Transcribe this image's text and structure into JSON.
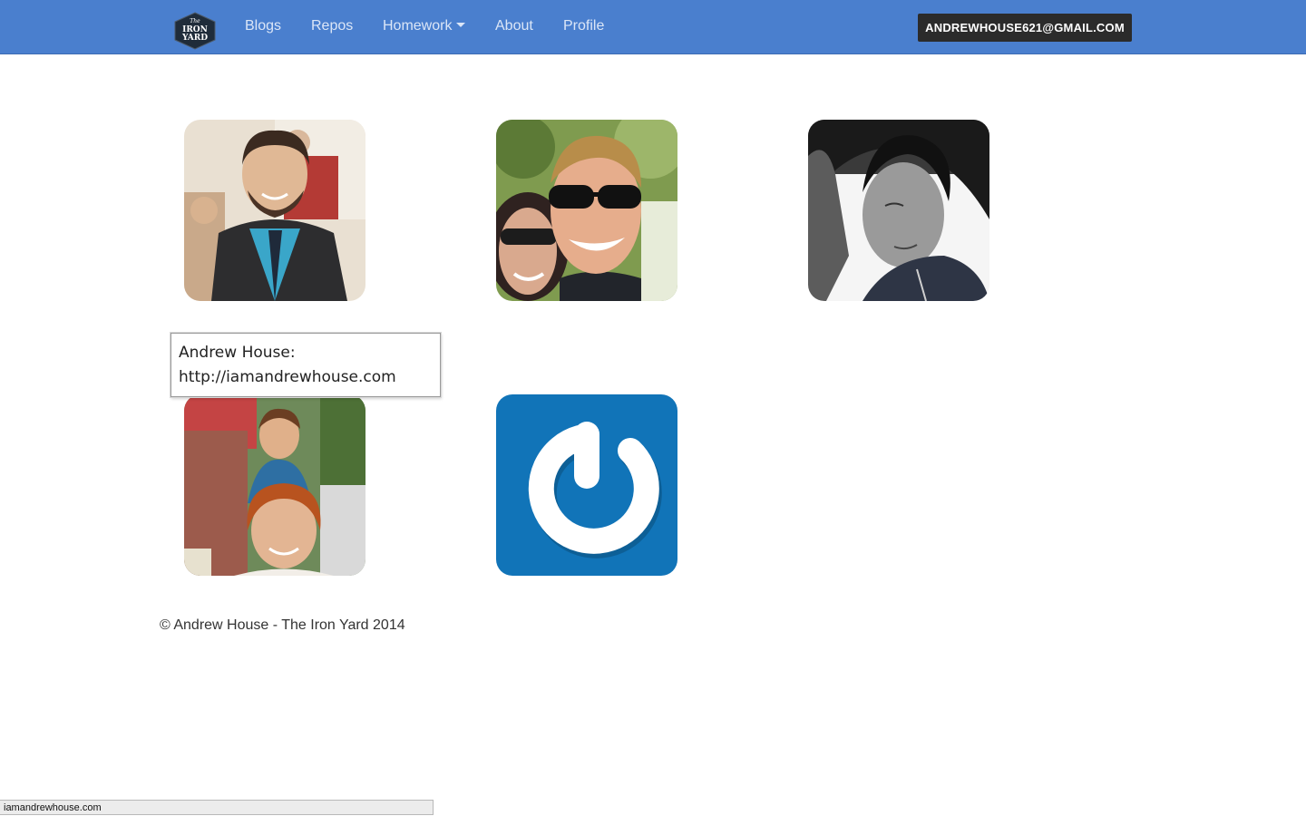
{
  "navbar": {
    "logo": {
      "line1": "The",
      "line2": "IRON",
      "line3": "YARD",
      "icon": "iron-yard-logo-icon"
    },
    "links": [
      {
        "label": "Blogs"
      },
      {
        "label": "Repos"
      },
      {
        "label": "Homework"
      },
      {
        "label": "About"
      },
      {
        "label": "Profile"
      }
    ],
    "user_email": "ANDREWHOUSE621@GMAIL.COM",
    "colors": {
      "background": "#4a7fce",
      "link": "#dbe6f7",
      "email_button": "#2b2b2b"
    }
  },
  "tooltip": {
    "line1": "Andrew House:",
    "line2": "http://iamandrewhouse.com"
  },
  "footer": {
    "text": "© Andrew House - The Iron Yard 2014"
  },
  "status_bar": {
    "url": "iamandrewhouse.com"
  }
}
